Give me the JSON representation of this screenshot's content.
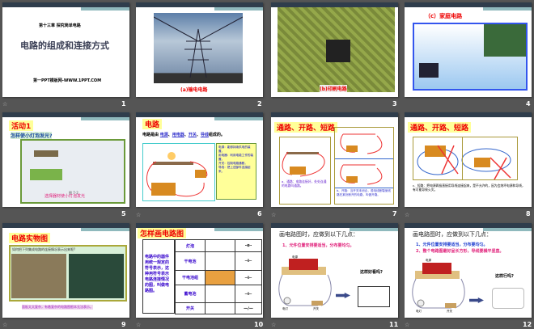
{
  "slides": [
    {
      "number": "1",
      "chapter": "第十三章 探究简单电路",
      "title": "电路的组成和连接方式",
      "site": "第一PPT模板网-WWW.1PPT.COM"
    },
    {
      "number": "2",
      "caption": "(a)输电电路"
    },
    {
      "number": "3",
      "caption": "(b)印刷电路"
    },
    {
      "number": "4",
      "caption": "（c）家庭电路"
    },
    {
      "number": "5",
      "heading": "活动1",
      "question": "怎样使小灯泡发光?",
      "figure": "图 7-2",
      "caption": "选择器材使小灯泡发光"
    },
    {
      "number": "6",
      "heading": "电路",
      "sentence_start": "电路是由",
      "blanks": [
        "电源",
        "用电器",
        "开关",
        "导线"
      ],
      "sentence_end": "组成的。",
      "notes": [
        "电源：能够持续供电的装置。",
        "用电器：利用电能工作的装置。",
        "开关：控制电路通断。",
        "导线：把上述部件连接起来。"
      ]
    },
    {
      "number": "7",
      "heading": "通路、开路、短路",
      "a_text": "a、通路：电路连接好，处处连通的电路叫通路。",
      "b_text": "b、开路：当开关未闭合，或电线断裂使线路在某处断开的电路，叫做开路。"
    },
    {
      "number": "8",
      "heading": "通路、开路、短路",
      "c_text": "c、短路：把电源两极直接用导线连接起来，是不允许的，因为会烧坏电源和导线，有可能导致火灾。"
    },
    {
      "number": "9",
      "heading": "电路实物图",
      "question": "如何把下列集成电路的连接情况表示出来呢?",
      "caption": "面板太太复杂，有着复杂的电路图根本无法表示。"
    },
    {
      "number": "10",
      "heading": "怎样画电路图",
      "left_text": "电路中的器件用统一规定的符号表示，这种用符号表示电路连接情况的图，叫做电路图。",
      "rows": [
        "灯泡",
        "干电池",
        "干电池组",
        "蓄电池",
        "开关"
      ],
      "symbols": [
        "-⊗-",
        "⊣⊢",
        "⊣⊢",
        "⊣⊢",
        "—∕—"
      ]
    },
    {
      "number": "11",
      "title": "画电路图时，应做到以下几点：",
      "point1": "1、元件位置安排要适当，分布要均匀。",
      "question": "这样好看吗?",
      "labels": [
        "电源",
        "电灯",
        "开关"
      ]
    },
    {
      "number": "12",
      "title": "画电路图时，应做到以下几点：",
      "point1": "1、元件位置安排要适当，分布要均匀。",
      "point2": "2、整个电路图最好呈长方形，导线要横平竖直。",
      "question": "这样行吗?",
      "labels": [
        "电源",
        "电灯",
        "开关"
      ]
    }
  ],
  "colors": {
    "background": "#555555",
    "accent_red": "#ee0000",
    "title_bar": "#2f3d4c"
  }
}
